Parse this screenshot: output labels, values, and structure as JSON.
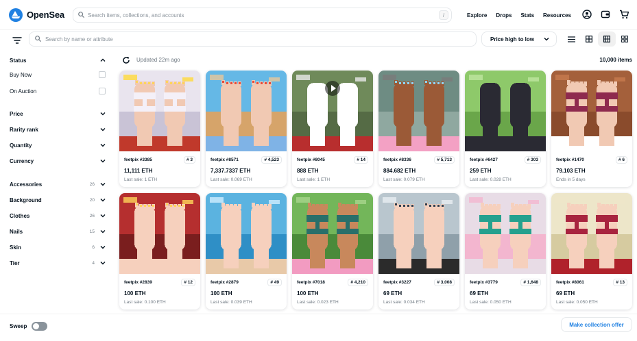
{
  "brand": {
    "name": "OpenSea"
  },
  "search": {
    "placeholder": "Search items, collections, and accounts",
    "shortcut": "/"
  },
  "nav": {
    "links": [
      "Explore",
      "Drops",
      "Stats",
      "Resources"
    ]
  },
  "filterbar": {
    "attr_placeholder": "Search by name or attribute",
    "sort_label": "Price high to low"
  },
  "sidebar": {
    "status": {
      "title": "Status",
      "options": [
        "Buy Now",
        "On Auction"
      ]
    },
    "filters": [
      "Price",
      "Rarity rank",
      "Quantity",
      "Currency"
    ],
    "traits": [
      {
        "name": "Accessories",
        "count": "26"
      },
      {
        "name": "Background",
        "count": "20"
      },
      {
        "name": "Clothes",
        "count": "26"
      },
      {
        "name": "Nails",
        "count": "15"
      },
      {
        "name": "Skin",
        "count": "6"
      },
      {
        "name": "Tier",
        "count": "4"
      }
    ]
  },
  "main": {
    "updated": "Updated 22m ago",
    "count": "10,000 items"
  },
  "items": [
    {
      "name": "feetpix #3385",
      "rank": "# 3",
      "price": "11,111 ETH",
      "sub": "Last sale: 1 ETH"
    },
    {
      "name": "feetpix #8571",
      "rank": "# 4,523",
      "price": "7,337.7337 ETH",
      "sub": "Last sale: 0.069 ETH"
    },
    {
      "name": "feetpix #8045",
      "rank": "# 14",
      "price": "888 ETH",
      "sub": "Last sale: 1 ETH"
    },
    {
      "name": "feetpix #8336",
      "rank": "# 5,713",
      "price": "884.682 ETH",
      "sub": "Last sale: 0.079 ETH"
    },
    {
      "name": "feetpix #6427",
      "rank": "# 303",
      "price": "259 ETH",
      "sub": "Last sale: 0.028 ETH"
    },
    {
      "name": "feetpix #1470",
      "rank": "# 6",
      "price": "79.103 ETH",
      "sub": "Ends in 5 days"
    },
    {
      "name": "feetpix #2839",
      "rank": "# 12",
      "price": "100 ETH",
      "sub": "Last sale: 0.100 ETH"
    },
    {
      "name": "feetpix #2879",
      "rank": "# 49",
      "price": "100 ETH",
      "sub": "Last sale: 0.039 ETH"
    },
    {
      "name": "feetpix #7018",
      "rank": "# 4,210",
      "price": "100 ETH",
      "sub": "Last sale: 0.023 ETH"
    },
    {
      "name": "feetpix #3227",
      "rank": "# 3,008",
      "price": "69 ETH",
      "sub": "Last sale: 0.034 ETH"
    },
    {
      "name": "feetpix #3779",
      "rank": "# 1,648",
      "price": "69 ETH",
      "sub": "Last sale: 0.050 ETH"
    },
    {
      "name": "feetpix #8061",
      "rank": "# 13",
      "price": "69 ETH",
      "sub": "Last sale: 0.050 ETH"
    }
  ],
  "art": [
    {
      "bg": "#e9e4ee",
      "floor": "#c9c3d6",
      "skin": "#f1c9b3",
      "sock": "",
      "shoe": "#f4f0f8",
      "nail": "#ffd45a",
      "pants": "#c0392b",
      "accent": "#ffd93b"
    },
    {
      "bg": "#65b8e6",
      "floor": "#d6a46a",
      "skin": "#f1c9b3",
      "sock": "",
      "shoe": "",
      "nail": "#e74c3c",
      "pants": "#7fb3e6",
      "accent": "#e9c79a"
    },
    {
      "bg": "#6f8a5a",
      "floor": "#556b45",
      "skin": "#f1c9b3",
      "sock": "#ffffff",
      "shoe": "",
      "nail": "",
      "pants": "#b82e2e",
      "accent": "#e8e8e8"
    },
    {
      "bg": "#6e8c83",
      "floor": "#8fa8a0",
      "skin": "#9b5a37",
      "sock": "",
      "shoe": "",
      "nail": "#8ed6ff",
      "pants": "#f3a1c4",
      "accent": "#7a7a7a"
    },
    {
      "bg": "#8ec96a",
      "floor": "#6aa64a",
      "skin": "#f1c9b3",
      "sock": "#2a2a33",
      "shoe": "",
      "nail": "",
      "pants": "#2a2a33",
      "accent": "#bfe6a0"
    },
    {
      "bg": "#a4603b",
      "floor": "#8a4b2c",
      "skin": "#f1c9b3",
      "sock": "",
      "shoe": "#8e2a4e",
      "nail": "",
      "pants": "#ffffff",
      "accent": "#c77b4f"
    },
    {
      "bg": "#b52f2f",
      "floor": "#7a1e1e",
      "skin": "#f6d0bd",
      "sock": "",
      "shoe": "",
      "nail": "#ffd45a",
      "pants": "#f6d0bd",
      "accent": "#ffd45a"
    },
    {
      "bg": "#5bb3e0",
      "floor": "#2f8fc6",
      "skin": "#f6d0bd",
      "sock": "",
      "shoe": "",
      "nail": "",
      "pants": "#e8c9a8",
      "accent": "#cfeeff"
    },
    {
      "bg": "#73b65a",
      "floor": "#4a8a3a",
      "skin": "#c8885c",
      "sock": "",
      "shoe": "#2a6f6a",
      "nail": "",
      "pants": "#f29bc1",
      "accent": "#a8d68c"
    },
    {
      "bg": "#b9c6ce",
      "floor": "#8fa0aa",
      "skin": "#f6d0bd",
      "sock": "",
      "shoe": "",
      "nail": "#2c3e50",
      "pants": "#2b2b2b",
      "accent": "#e8eef2"
    },
    {
      "bg": "#e8dce6",
      "floor": "#f3b6cf",
      "skin": "#f6d0bd",
      "sock": "",
      "shoe": "#25a18e",
      "nail": "",
      "pants": "#e8dce6",
      "accent": "#f3b6cf"
    },
    {
      "bg": "#ede6c9",
      "floor": "#d6cba0",
      "skin": "#f6d0bd",
      "sock": "",
      "shoe": "#a8243f",
      "nail": "",
      "pants": "#b0222b",
      "accent": "#ede6c9"
    }
  ],
  "bottom": {
    "sweep": "Sweep",
    "offer": "Make collection offer"
  },
  "colors": {
    "brand": "#2081e2",
    "text": "#04111d",
    "muted": "#707a83"
  },
  "icons": [
    "search-icon",
    "user-icon",
    "wallet-icon",
    "cart-icon",
    "filter-icon",
    "chevron-down-icon",
    "chevron-up-icon",
    "refresh-icon",
    "list-view-icon",
    "grid-view-icon",
    "play-icon"
  ]
}
